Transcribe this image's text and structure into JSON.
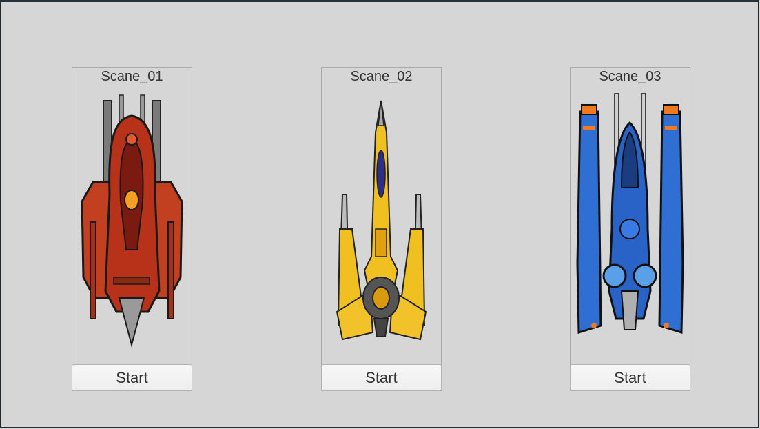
{
  "scenes": [
    {
      "title": "Scane_01",
      "button": "Start",
      "ship_icon": "red-spaceship-icon",
      "color": "#b8321a"
    },
    {
      "title": "Scane_02",
      "button": "Start",
      "ship_icon": "yellow-spaceship-icon",
      "color": "#f0c020"
    },
    {
      "title": "Scane_03",
      "button": "Start",
      "ship_icon": "blue-spaceship-icon",
      "color": "#2f6fd4"
    }
  ]
}
